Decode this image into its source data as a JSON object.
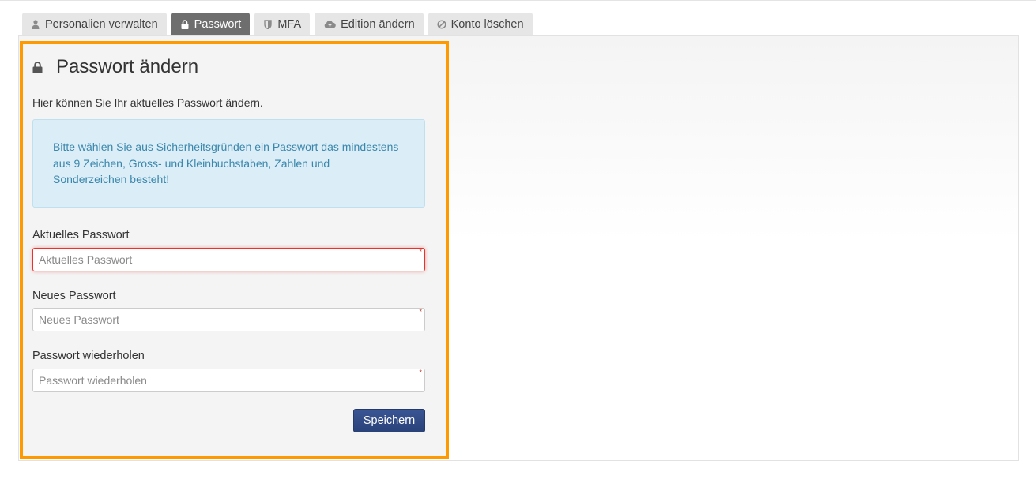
{
  "tabs": [
    {
      "label": "Personalien verwalten",
      "icon": "user-icon",
      "active": false
    },
    {
      "label": "Passwort",
      "icon": "lock-icon",
      "active": true
    },
    {
      "label": "MFA",
      "icon": "shield-icon",
      "active": false
    },
    {
      "label": "Edition ändern",
      "icon": "cloud-upload-icon",
      "active": false
    },
    {
      "label": "Konto löschen",
      "icon": "ban-icon",
      "active": false
    }
  ],
  "section": {
    "title": "Passwort ändern",
    "title_icon": "lock-icon",
    "intro": "Hier können Sie Ihr aktuelles Passwort ändern.",
    "alert": "Bitte wählen Sie aus Sicherheitsgründen ein Passwort das mindestens aus 9 Zeichen, Gross- und Kleinbuchstaben, Zahlen und Sonderzeichen besteht!"
  },
  "form": {
    "current": {
      "label": "Aktuelles Passwort",
      "placeholder": "Aktuelles Passwort",
      "value": "",
      "required_mark": "*"
    },
    "new": {
      "label": "Neues Passwort",
      "placeholder": "Neues Passwort",
      "value": "",
      "required_mark": "*"
    },
    "repeat": {
      "label": "Passwort wiederholen",
      "placeholder": "Passwort wiederholen",
      "value": "",
      "required_mark": "*"
    },
    "save_label": "Speichern"
  },
  "colors": {
    "highlight": "#ff9900",
    "active_tab": "#6e6e6e",
    "alert_bg": "#dbedf6",
    "alert_text": "#3a87ad",
    "primary_button": "#2f4a86",
    "invalid_border": "#e9322d"
  }
}
